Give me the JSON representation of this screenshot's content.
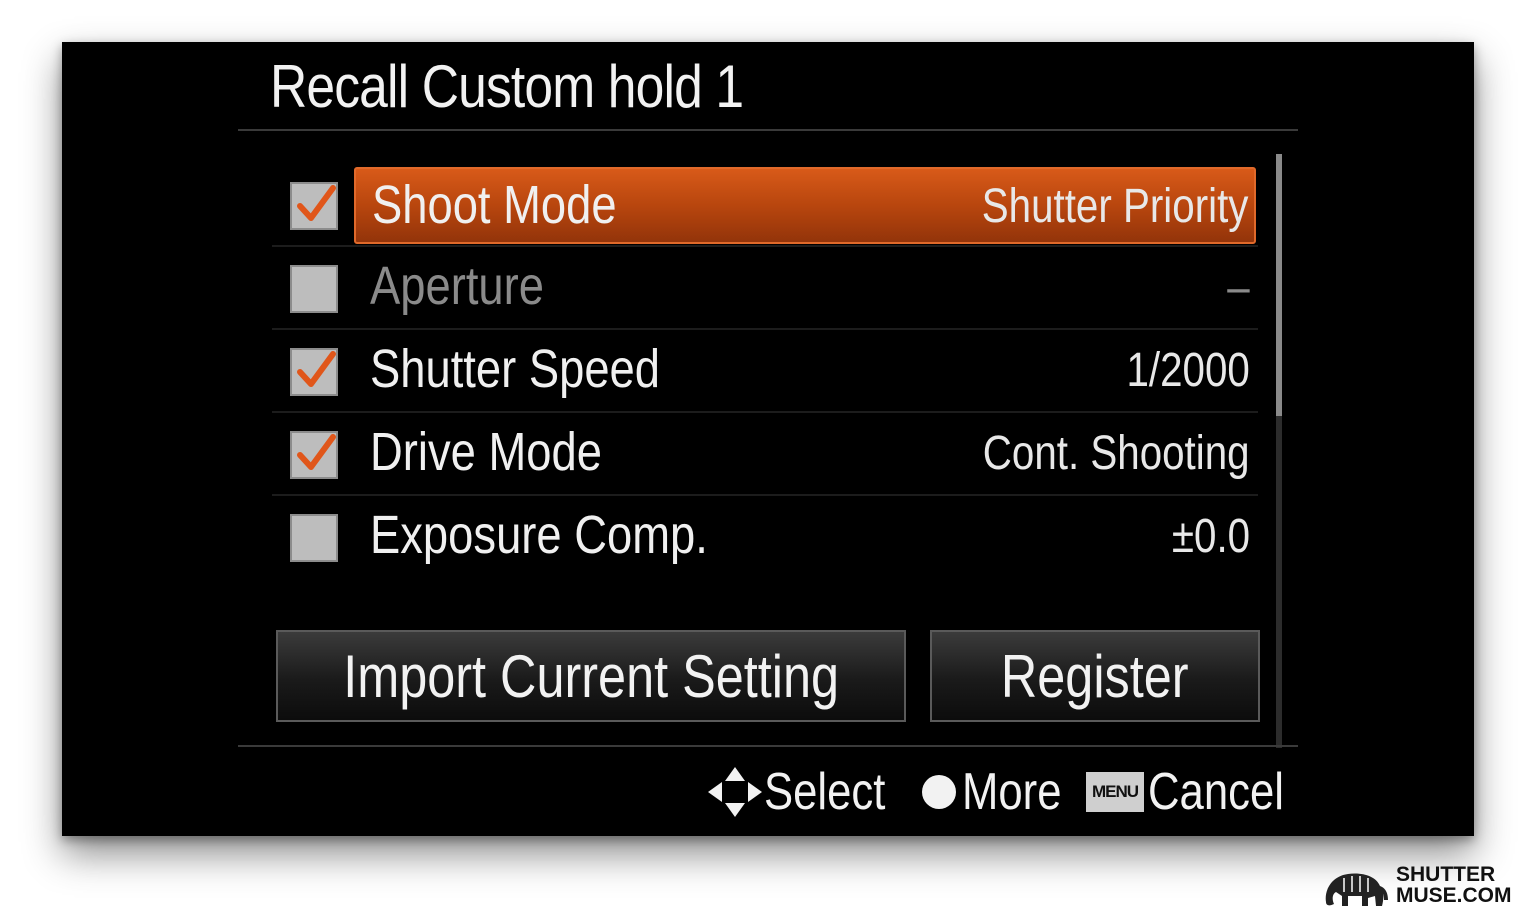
{
  "dialog": {
    "title": "Recall Custom hold 1"
  },
  "items": [
    {
      "label": "Shoot Mode",
      "value": "Shutter Priority",
      "checked": true,
      "selected": true,
      "enabled": true
    },
    {
      "label": "Aperture",
      "value": "–",
      "checked": false,
      "selected": false,
      "enabled": false
    },
    {
      "label": "Shutter Speed",
      "value": "1/2000",
      "checked": true,
      "selected": false,
      "enabled": true
    },
    {
      "label": "Drive Mode",
      "value": "Cont. Shooting",
      "checked": true,
      "selected": false,
      "enabled": true
    },
    {
      "label": "Exposure Comp.",
      "value": "±0.0",
      "checked": false,
      "selected": false,
      "enabled": true
    }
  ],
  "buttons": {
    "import_label": "Import Current Setting",
    "register_label": "Register"
  },
  "footer": {
    "select_label": "Select",
    "more_label": "More",
    "menu_badge": "MENU",
    "cancel_label": "Cancel"
  },
  "watermark": {
    "line1": "SHUTTER",
    "line2": "MUSE.COM"
  },
  "colors": {
    "accent": "#c4500f",
    "check_mark": "#e0561a",
    "background": "#000000",
    "text": "#f0f0f0"
  },
  "icons": {
    "checkbox_checked": "checkmark-icon",
    "select": "dpad-arrows-icon",
    "more": "circle-button-icon",
    "cancel": "menu-button-icon",
    "logo": "elephant-logo-icon"
  }
}
